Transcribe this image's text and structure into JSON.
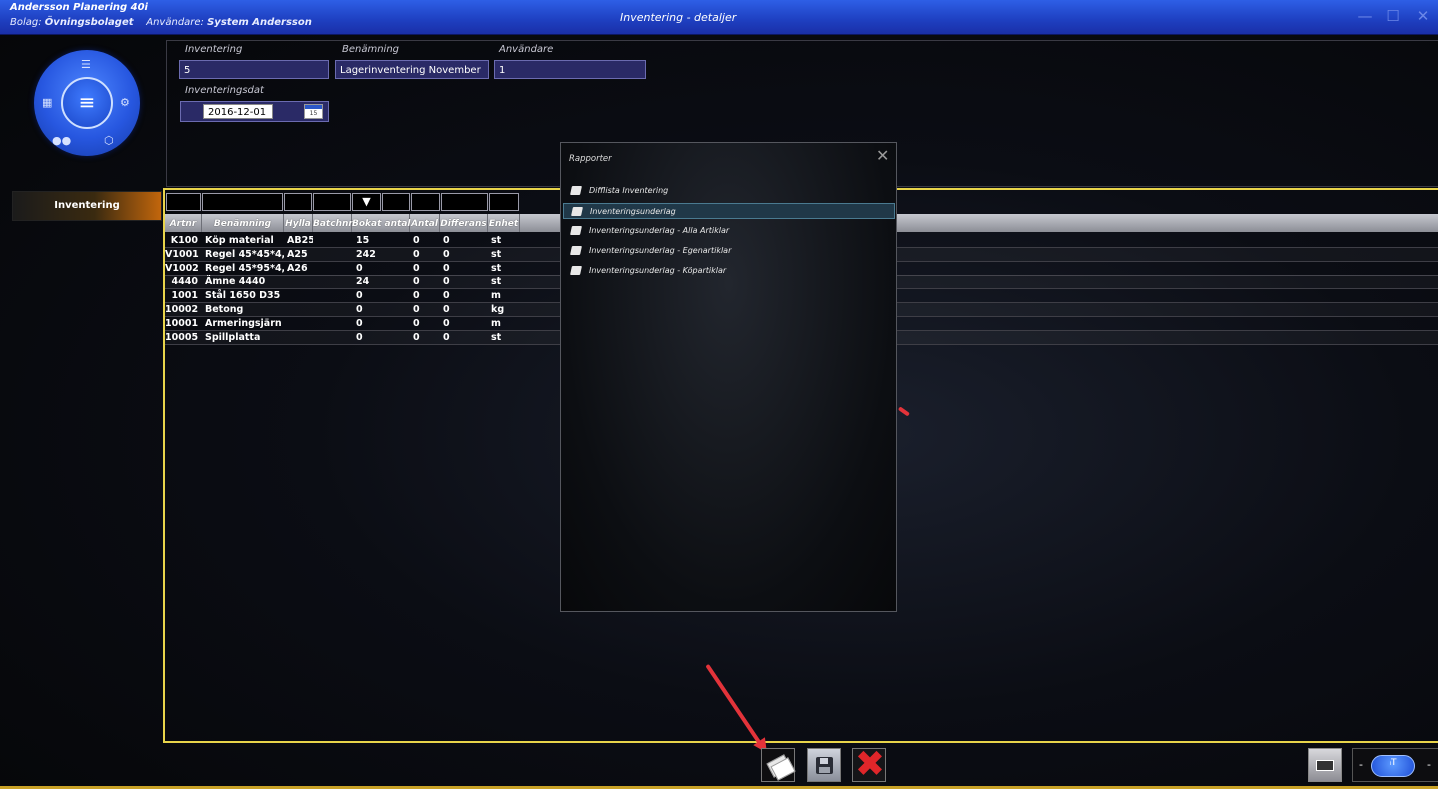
{
  "window": {
    "app_name": "Andersson Planering 40i",
    "company_label": "Bolag:",
    "company_value": "Övningsbolaget",
    "user_label": "Användare:",
    "user_value": "System Andersson",
    "title": "Inventering - detaljer"
  },
  "nav": {
    "active_item": "Inventering"
  },
  "header_form": {
    "inventering_label": "Inventering",
    "inventering_value": "5",
    "benamning_label": "Benämning",
    "benamning_value": "Lagerinventering November",
    "anvandare_label": "Användare",
    "anvandare_value": "1",
    "datum_label": "Inventeringsdat",
    "datum_value": "2016-12-01",
    "calendar_day": "15"
  },
  "grid": {
    "columns": [
      "Artnr",
      "Benämning",
      "Hylla",
      "Batchnr",
      "Bokat antal",
      "Antal",
      "Differans",
      "Enhet"
    ],
    "rows": [
      [
        "K100",
        "Köp material",
        "AB25",
        "",
        "15",
        "0",
        "0",
        "st"
      ],
      [
        "V1001",
        "Regel 45*45*4,5",
        "A25",
        "",
        "242",
        "0",
        "0",
        "st"
      ],
      [
        "V1002",
        "Regel 45*95*4,5",
        "A26",
        "",
        "0",
        "0",
        "0",
        "st"
      ],
      [
        "4440",
        "Ämne 4440",
        "",
        "",
        "24",
        "0",
        "0",
        "st"
      ],
      [
        "1001",
        "Stål 1650 D35",
        "",
        "",
        "0",
        "0",
        "0",
        "m"
      ],
      [
        "10002",
        "Betong",
        "",
        "",
        "0",
        "0",
        "0",
        "kg"
      ],
      [
        "10001",
        "Armeringsjärn",
        "",
        "",
        "0",
        "0",
        "0",
        "m"
      ],
      [
        "10005",
        "Spillplatta",
        "",
        "",
        "0",
        "0",
        "0",
        "st"
      ]
    ]
  },
  "reports_popup": {
    "title": "Rapporter",
    "items": [
      "Difflista Inventering",
      "Inventeringsunderlag",
      "Inventeringsunderlag - Alla Artiklar",
      "Inventeringsunderlag - Egenartiklar",
      "Inventeringsunderlag - Köpartiklar"
    ],
    "selected_index": 1
  },
  "zoom": {
    "minus": "-",
    "plus": "-"
  },
  "colors": {
    "titlebar": "#2552d8",
    "grid_border": "#e8d44a",
    "nav_active": "#c2660c",
    "annotation_arrow": "#e3333a"
  }
}
